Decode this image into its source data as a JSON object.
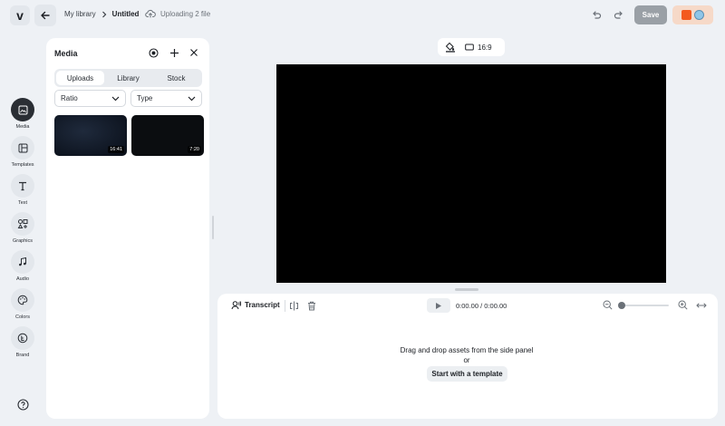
{
  "topbar": {
    "logo": "v",
    "breadcrumb": {
      "library": "My library",
      "current": "Untitled"
    },
    "upload_status": "Uploading 2 file",
    "save_label": "Save"
  },
  "rail": {
    "items": [
      {
        "label": "Media",
        "icon": "media-icon",
        "active": true
      },
      {
        "label": "Templates",
        "icon": "templates-icon"
      },
      {
        "label": "Text",
        "icon": "text-icon"
      },
      {
        "label": "Graphics",
        "icon": "graphics-icon"
      },
      {
        "label": "Audio",
        "icon": "music-icon"
      },
      {
        "label": "Colors",
        "icon": "palette-icon"
      },
      {
        "label": "Brand",
        "icon": "brand-icon"
      }
    ]
  },
  "media_panel": {
    "title": "Media",
    "tabs": [
      {
        "label": "Uploads",
        "active": true
      },
      {
        "label": "Library"
      },
      {
        "label": "Stock"
      }
    ],
    "filters": {
      "ratio": "Ratio",
      "type": "Type"
    },
    "thumbnails": [
      {
        "duration": "16:41"
      },
      {
        "duration": "7:20"
      }
    ]
  },
  "canvas": {
    "aspect": "16:9"
  },
  "timeline": {
    "transcript_label": "Transcript",
    "time": "0:00.00 / 0:00.00",
    "empty_message": "Drag and drop assets from the side panel",
    "or": "or",
    "template_button": "Start with a template"
  },
  "colors": {
    "accent_dark": "#2a2e34",
    "save_disabled": "#9aa0a6",
    "background": "#eef1f5"
  }
}
